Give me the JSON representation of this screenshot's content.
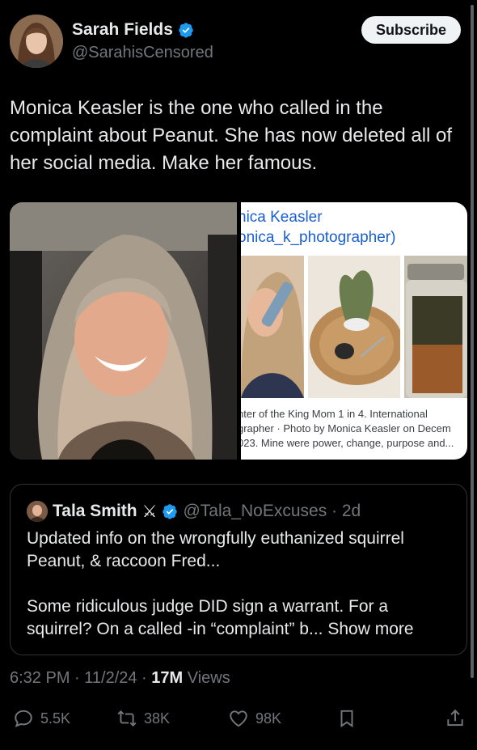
{
  "author": {
    "display_name": "Sarah Fields",
    "handle": "@SarahisCensored",
    "avatar_icon": "avatar-photo",
    "verified_icon": "verified-badge-icon"
  },
  "subscribe_label": "Subscribe",
  "tweet_text": "Monica Keasler is the one who called in the complaint about Peanut. She has now deleted all of her social media. Make her famous.",
  "media": {
    "left_photo": "photo of a smiling woman in a car",
    "right_screenshot": {
      "title_line1": "nica Keasler",
      "title_line2": "onica_k_photographer)",
      "caption_line1": "nter of the King Mom 1 in 4. International",
      "caption_line2": "grapher · Photo by Monica Keasler on Decem",
      "caption_line3": "023. Mine were power, change, purpose and..."
    }
  },
  "quote": {
    "display_name": "Tala Smith",
    "emoji": "⚔",
    "handle_time": "@Tala_NoExcuses · 2d",
    "body_p1": "Updated info on the wrongfully euthanized squirrel Peanut, & raccoon Fred...",
    "body_p2": "Some ridiculous judge DID sign a warrant. For a squirrel? On a called -in “complaint” b...",
    "show_more": "Show more"
  },
  "meta": {
    "time_date": "6:32 PM · 11/2/24 · ",
    "views_count": "17M",
    "views_label": " Views"
  },
  "actions": {
    "replies": "5.5K",
    "reposts": "38K",
    "likes": "98K"
  },
  "colors": {
    "background": "#000000",
    "text": "#e7e9ea",
    "secondary": "#71767b",
    "verified": "#1d9bf0",
    "link": "#1a5fd1"
  }
}
